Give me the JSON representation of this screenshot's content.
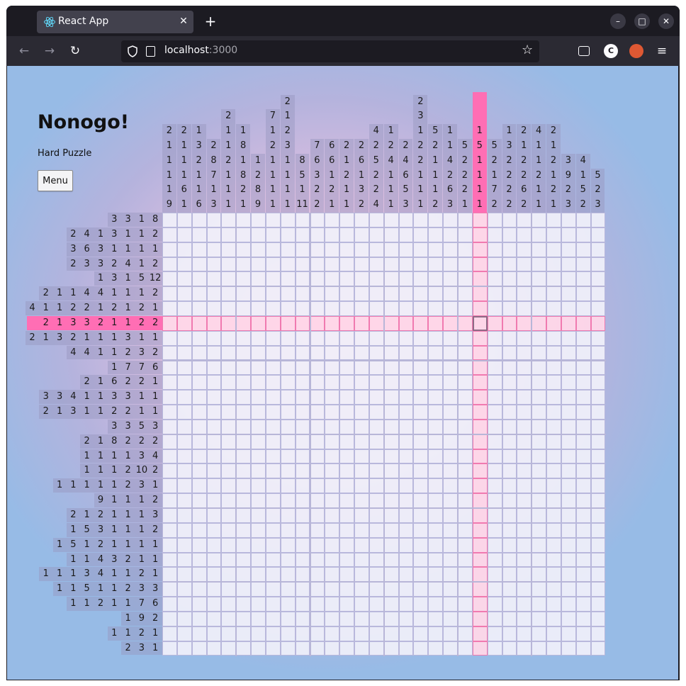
{
  "browser": {
    "tab_title": "React App",
    "tab_close": "✕",
    "new_tab": "+",
    "url_host": "localhost",
    "url_port": ":3000",
    "nav": {
      "back": "←",
      "forward": "→",
      "reload": "↻"
    },
    "star": "☆",
    "window_controls": {
      "minimize": "–",
      "maximize": "□",
      "close": "✕"
    }
  },
  "app": {
    "title": "Nonogo!",
    "difficulty": "Hard Puzzle",
    "menu_label": "Menu"
  },
  "puzzle": {
    "highlight_row": 7,
    "highlight_col": 21,
    "highlight_color": "#ff6eb4",
    "column_clues": [
      [
        "2",
        "1",
        "1",
        "1",
        "1",
        "9"
      ],
      [
        "2",
        "1",
        "1",
        "1",
        "6",
        "1"
      ],
      [
        "1",
        "3",
        "2",
        "1",
        "1",
        "6"
      ],
      [
        "2",
        "8",
        "7",
        "1",
        "3"
      ],
      [
        "2",
        "1",
        "1",
        "2",
        "1",
        "1",
        "1"
      ],
      [
        "1",
        "8",
        "1",
        "8",
        "2",
        "1"
      ],
      [
        "1",
        "2",
        "8",
        "9"
      ],
      [
        "7",
        "1",
        "2",
        "1",
        "1",
        "1",
        "1"
      ],
      [
        "2",
        "1",
        "2",
        "3",
        "1",
        "1",
        "1",
        "1"
      ],
      [
        "8",
        "5",
        "1",
        "11"
      ],
      [
        "7",
        "6",
        "3",
        "2",
        "2"
      ],
      [
        "6",
        "6",
        "1",
        "2",
        "1"
      ],
      [
        "2",
        "1",
        "2",
        "1",
        "1"
      ],
      [
        "2",
        "6",
        "1",
        "3",
        "2"
      ],
      [
        "4",
        "2",
        "5",
        "2",
        "2",
        "4"
      ],
      [
        "1",
        "2",
        "4",
        "1",
        "1",
        "1"
      ],
      [
        "2",
        "4",
        "6",
        "5",
        "3"
      ],
      [
        "2",
        "3",
        "1",
        "2",
        "2",
        "1",
        "1",
        "1"
      ],
      [
        "5",
        "2",
        "1",
        "1",
        "1",
        "2"
      ],
      [
        "1",
        "1",
        "4",
        "2",
        "6",
        "3"
      ],
      [
        "5",
        "2",
        "2",
        "2",
        "1"
      ],
      [
        "1",
        "5",
        "1",
        "1",
        "1",
        "1"
      ],
      [
        "5",
        "2",
        "1",
        "7",
        "2"
      ],
      [
        "1",
        "3",
        "2",
        "2",
        "2",
        "2"
      ],
      [
        "2",
        "1",
        "2",
        "2",
        "6",
        "2"
      ],
      [
        "4",
        "1",
        "1",
        "2",
        "1",
        "1"
      ],
      [
        "2",
        "1",
        "2",
        "1",
        "2",
        "1"
      ],
      [
        "3",
        "9",
        "2",
        "3"
      ],
      [
        "4",
        "1",
        "5",
        "2"
      ],
      [
        "5",
        "2",
        "3"
      ]
    ],
    "row_clues": [
      [
        "3",
        "3",
        "1",
        "8"
      ],
      [
        "2",
        "4",
        "1",
        "3",
        "1",
        "1",
        "2"
      ],
      [
        "3",
        "6",
        "3",
        "1",
        "1",
        "1",
        "1"
      ],
      [
        "2",
        "3",
        "3",
        "2",
        "4",
        "1",
        "2"
      ],
      [
        "1",
        "3",
        "1",
        "5",
        "12"
      ],
      [
        "2",
        "1",
        "1",
        "4",
        "4",
        "1",
        "1",
        "1",
        "2"
      ],
      [
        "4",
        "1",
        "1",
        "2",
        "2",
        "1",
        "2",
        "1",
        "2",
        "1"
      ],
      [
        "2",
        "1",
        "3",
        "3",
        "2",
        "1",
        "1",
        "2",
        "2"
      ],
      [
        "2",
        "1",
        "3",
        "2",
        "1",
        "1",
        "1",
        "3",
        "1",
        "1"
      ],
      [
        "4",
        "4",
        "1",
        "1",
        "2",
        "3",
        "2"
      ],
      [
        "1",
        "7",
        "7",
        "6"
      ],
      [
        "2",
        "1",
        "6",
        "2",
        "2",
        "1"
      ],
      [
        "3",
        "3",
        "4",
        "1",
        "1",
        "3",
        "3",
        "1",
        "1"
      ],
      [
        "2",
        "1",
        "3",
        "1",
        "1",
        "2",
        "2",
        "1",
        "1"
      ],
      [
        "3",
        "3",
        "5",
        "3"
      ],
      [
        "2",
        "1",
        "8",
        "2",
        "2",
        "2"
      ],
      [
        "1",
        "1",
        "1",
        "1",
        "3",
        "4"
      ],
      [
        "1",
        "1",
        "1",
        "2",
        "10",
        "2"
      ],
      [
        "1",
        "1",
        "1",
        "1",
        "1",
        "2",
        "3",
        "1"
      ],
      [
        "9",
        "1",
        "1",
        "1",
        "2"
      ],
      [
        "2",
        "1",
        "2",
        "1",
        "1",
        "1",
        "3"
      ],
      [
        "1",
        "5",
        "3",
        "1",
        "1",
        "1",
        "2"
      ],
      [
        "1",
        "5",
        "1",
        "2",
        "1",
        "1",
        "1",
        "1"
      ],
      [
        "1",
        "1",
        "4",
        "3",
        "2",
        "1",
        "1"
      ],
      [
        "1",
        "1",
        "1",
        "3",
        "4",
        "1",
        "1",
        "2",
        "1"
      ],
      [
        "1",
        "1",
        "5",
        "1",
        "1",
        "2",
        "3",
        "3"
      ],
      [
        "1",
        "1",
        "2",
        "1",
        "1",
        "7",
        "6"
      ],
      [
        "1",
        "9",
        "2"
      ],
      [
        "1",
        "1",
        "2",
        "1"
      ],
      [
        "2",
        "3",
        "1"
      ]
    ]
  }
}
